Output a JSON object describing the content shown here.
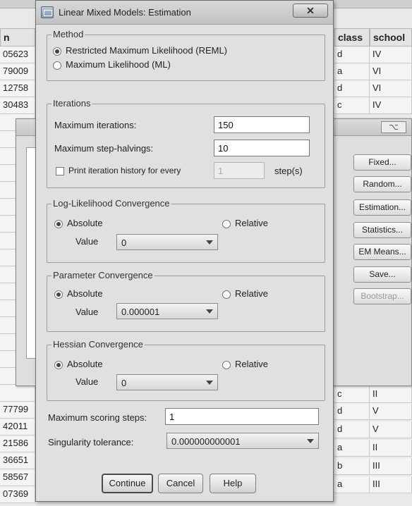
{
  "background_grid": {
    "left_header": "n",
    "left_cells": [
      "05623",
      "79009",
      "12758",
      "30483",
      "",
      "",
      "",
      "",
      "",
      "",
      "",
      "",
      "",
      "",
      "",
      "",
      "",
      "",
      "",
      "",
      "",
      "77799",
      "42011",
      "21586",
      "36651",
      "58567",
      "07369"
    ],
    "columns": [
      {
        "label": "class",
        "cells": [
          "d",
          "a",
          "d",
          "c"
        ]
      },
      {
        "label": "school",
        "cells": [
          "IV",
          "VI",
          "VI",
          "IV"
        ]
      }
    ],
    "bottom_rows": [
      {
        "class": "c",
        "school": "II"
      },
      {
        "class": "d",
        "school": "V"
      },
      {
        "class": "d",
        "school": "V"
      },
      {
        "class": "a",
        "school": "II"
      },
      {
        "class": "b",
        "school": "III"
      },
      {
        "class": "a",
        "school": "III"
      }
    ]
  },
  "background_dialog": {
    "close_glyph": "⌥",
    "side_buttons": [
      {
        "label": "Fixed...",
        "disabled": false
      },
      {
        "label": "Random...",
        "disabled": false
      },
      {
        "label": "Estimation...",
        "disabled": false
      },
      {
        "label": "Statistics...",
        "disabled": false
      },
      {
        "label": "EM Means...",
        "disabled": false
      },
      {
        "label": "Save...",
        "disabled": false
      },
      {
        "label": "Bootstrap...",
        "disabled": true
      }
    ]
  },
  "dialog": {
    "title": "Linear Mixed Models: Estimation",
    "close_glyph": "✕",
    "method": {
      "legend": "Method",
      "options": [
        {
          "label": "Restricted Maximum Likelihood (REML)",
          "selected": true
        },
        {
          "label": "Maximum Likelihood (ML)",
          "selected": false
        }
      ]
    },
    "iterations": {
      "legend": "Iterations",
      "max_iterations_label": "Maximum iterations:",
      "max_iterations_value": "150",
      "max_step_halvings_label": "Maximum step-halvings:",
      "max_step_halvings_value": "10",
      "print_history_label": "Print iteration history for every",
      "print_history_value": "1",
      "print_history_unit": "step(s)"
    },
    "log_likelihood": {
      "legend": "Log-Likelihood Convergence",
      "absolute_label": "Absolute",
      "relative_label": "Relative",
      "value_label": "Value",
      "value": "0"
    },
    "parameter": {
      "legend": "Parameter Convergence",
      "absolute_label": "Absolute",
      "relative_label": "Relative",
      "value_label": "Value",
      "value": "0.000001"
    },
    "hessian": {
      "legend": "Hessian Convergence",
      "absolute_label": "Absolute",
      "relative_label": "Relative",
      "value_label": "Value",
      "value": "0"
    },
    "max_scoring_label": "Maximum scoring steps:",
    "max_scoring_value": "1",
    "singularity_label": "Singularity tolerance:",
    "singularity_value": "0.000000000001",
    "buttons": {
      "continue": "Continue",
      "cancel": "Cancel",
      "help": "Help"
    }
  }
}
